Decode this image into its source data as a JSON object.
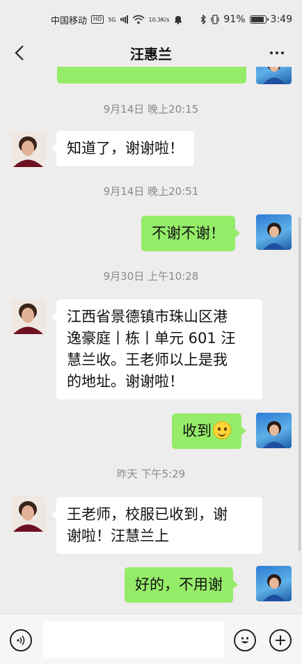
{
  "status_bar": {
    "carrier": "中国移动",
    "hd": "HD",
    "network": "5G",
    "speed_value": "10.3",
    "speed_unit": "K/s",
    "battery": "91%",
    "time": "3:49"
  },
  "header": {
    "title": "汪惠兰"
  },
  "messages": [
    {
      "type": "time",
      "text": "9月14日 晚上20:15"
    },
    {
      "type": "msg",
      "side": "left",
      "text": "知道了，谢谢啦！"
    },
    {
      "type": "time",
      "text": "9月14日 晚上20:51"
    },
    {
      "type": "msg",
      "side": "right",
      "text": "不谢不谢！"
    },
    {
      "type": "time",
      "text": "9月30日 上午10:28"
    },
    {
      "type": "msg",
      "side": "left",
      "lines": [
        "江西省景德镇市珠山区港",
        "逸豪庭丨栋丨单元 601 汪",
        "慧兰收。王老师以上是我",
        "的地址。谢谢啦！"
      ]
    },
    {
      "type": "msg",
      "side": "right",
      "text": "收到",
      "emoji": "smile-emoji"
    },
    {
      "type": "time",
      "text": "昨天 下午5:29"
    },
    {
      "type": "msg",
      "side": "left",
      "lines": [
        "王老师，校服已收到，谢",
        "谢啦！汪慧兰上"
      ]
    },
    {
      "type": "msg",
      "side": "right",
      "text": "好的，不用谢"
    }
  ],
  "input": {
    "value": "",
    "placeholder": ""
  },
  "colors": {
    "background": "#ededed",
    "bubble_right": "#95ec69",
    "bubble_left": "#ffffff",
    "time_text": "#8a8a8a"
  },
  "icons": {
    "back": "chevron-left-icon",
    "more": "more-dots-icon",
    "voice": "voice-icon",
    "emoji": "emoji-icon",
    "add": "plus-icon"
  }
}
